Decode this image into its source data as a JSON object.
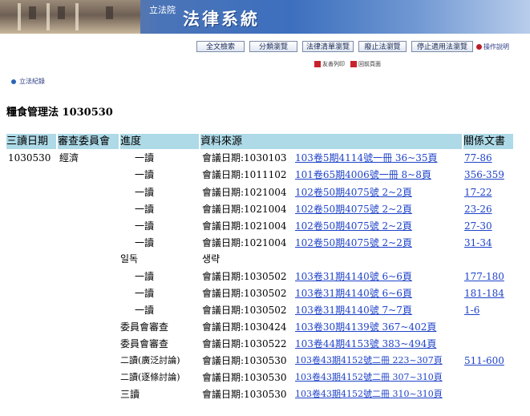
{
  "banner": {
    "org": "立法院",
    "system_title": "法律系統"
  },
  "nav": [
    {
      "label": "全文檢索"
    },
    {
      "label": "分類瀏覽"
    },
    {
      "label": "法律清單瀏覽"
    },
    {
      "label": "廢止法瀏覽"
    },
    {
      "label": "停止適用法瀏覽"
    }
  ],
  "help_label": "操作說明",
  "sub_links": [
    {
      "label": "友善列印"
    },
    {
      "label": "回前頁面"
    }
  ],
  "record_link": "立法紀錄",
  "page_title": "糧食管理法 1030530",
  "table": {
    "headers": [
      "三讀日期",
      "審查委員會",
      "進度",
      "資料來源",
      "關係文書"
    ],
    "rows": [
      {
        "date": "1030530",
        "committee": "經濟",
        "stage": "一讀",
        "meeting": "會議日期:1030103",
        "source": "103卷5期4114號一冊 36~35頁",
        "doc": "77-86"
      },
      {
        "date": "",
        "committee": "",
        "stage": "一讀",
        "meeting": "會議日期:1011102",
        "source": "101卷65期4006號一冊 8~8頁",
        "doc": "356-359"
      },
      {
        "date": "",
        "committee": "",
        "stage": "一讀",
        "meeting": "會議日期:1021004",
        "source": "102卷50期4075號 2~2頁",
        "doc": "17-22"
      },
      {
        "date": "",
        "committee": "",
        "stage": "一讀",
        "meeting": "會議日期:1021004",
        "source": "102卷50期4075號 2~2頁",
        "doc": "23-26"
      },
      {
        "date": "",
        "committee": "",
        "stage": "一讀",
        "meeting": "會議日期:1021004",
        "source": "102卷50期4075號 2~2頁",
        "doc": "27-30"
      },
      {
        "date": "",
        "committee": "",
        "stage": "一讀",
        "meeting": "會議日期:1021004",
        "source": "102卷50期4075號 2~2頁",
        "doc": "31-34"
      },
      {
        "date": "",
        "committee": "",
        "stage": "일독",
        "meeting": "생략",
        "source": "",
        "doc": ""
      },
      {
        "date": "",
        "committee": "",
        "stage": "一讀",
        "meeting": "會議日期:1030502",
        "source": "103卷31期4140號 6~6頁",
        "doc": "177-180"
      },
      {
        "date": "",
        "committee": "",
        "stage": "一讀",
        "meeting": "會議日期:1030502",
        "source": "103卷31期4140號 6~6頁",
        "doc": "181-184"
      },
      {
        "date": "",
        "committee": "",
        "stage": "一讀",
        "meeting": "會議日期:1030502",
        "source": "103卷31期4140號 7~7頁",
        "doc": "1-6"
      },
      {
        "date": "",
        "committee": "",
        "stage": "委員會審查",
        "meeting": "會議日期:1030424",
        "source": "103卷30期4139號 367~402頁",
        "doc": ""
      },
      {
        "date": "",
        "committee": "",
        "stage": "委員會審查",
        "meeting": "會議日期:1030522",
        "source": "103卷44期4153號 383~494頁",
        "doc": ""
      },
      {
        "date": "",
        "committee": "",
        "stage": "二讀(廣泛討論)",
        "meeting": "會議日期:1030530",
        "source": "103卷43期4152號二冊 223~307頁",
        "doc": "511-600"
      },
      {
        "date": "",
        "committee": "",
        "stage": "二讀(逐條討論)",
        "meeting": "會議日期:1030530",
        "source": "103卷43期4152號二冊 307~310頁",
        "doc": ""
      },
      {
        "date": "",
        "committee": "",
        "stage": "三讀",
        "meeting": "會議日期:1030530",
        "source": "103卷43期4152號二冊 310~310頁",
        "doc": ""
      }
    ]
  }
}
